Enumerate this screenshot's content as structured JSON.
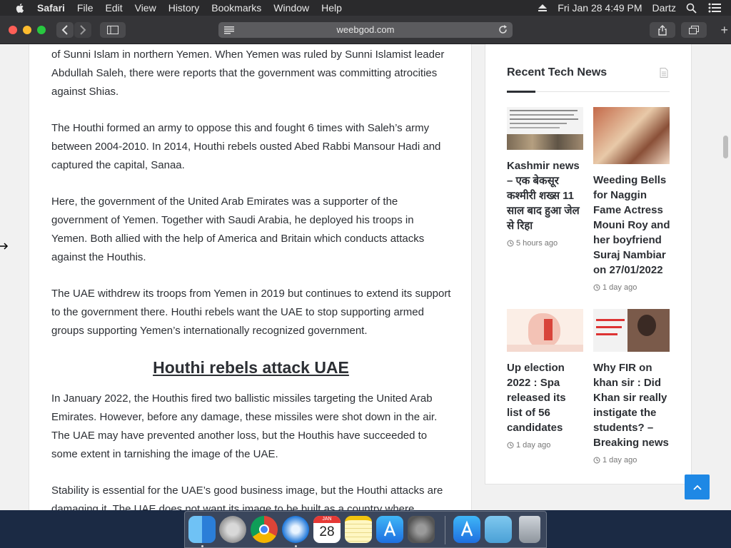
{
  "menubar": {
    "app": "Safari",
    "menus": [
      "File",
      "Edit",
      "View",
      "History",
      "Bookmarks",
      "Window",
      "Help"
    ],
    "datetime": "Fri Jan 28  4:49 PM",
    "user": "Dartz"
  },
  "browser": {
    "url": "weebgod.com"
  },
  "article": {
    "paragraphs": [
      "of Sunni Islam in northern Yemen. When Yemen was ruled by Sunni Islamist leader Abdullah Saleh, there were reports that the government was committing atrocities against Shias.",
      "The Houthi formed an army to oppose this and fought 6 times with Saleh’s army between 2004-2010. In 2014, Houthi rebels ousted Abed Rabbi Mansour Hadi and captured the capital, Sanaa.",
      "Here, the government of the United Arab Emirates was a supporter of the government of Yemen. Together with Saudi Arabia, he deployed his troops in Yemen. Both allied with the help of America and Britain which conducts attacks against the Houthis.",
      "The UAE withdrew its troops from Yemen in 2019 but continues to extend its support to the government there. Houthi rebels want the UAE to stop supporting armed groups supporting Yemen’s internationally recognized government."
    ],
    "heading": "Houthi rebels attack UAE",
    "paragraphs2": [
      "In January 2022, the Houthis fired two ballistic missiles targeting the United Arab Emirates. However, before any damage, these missiles were shot down in the air. The UAE may have prevented another loss, but the Houthis have succeeded to some extent in tarnishing the image of the UAE.",
      "Stability is essential for the UAE’s good business image, but the Houthi attacks are damaging it. The UAE does not want its image to be built as a country where"
    ]
  },
  "sidebar": {
    "title": "Recent Tech News",
    "items": [
      {
        "title": "Kashmir news – एक बेकसूर कश्मीरी शख्स 11 साल बाद हुआ जेल से रिहा",
        "time": "5 hours ago"
      },
      {
        "title": "Weeding Bells for Naggin Fame Actress Mouni Roy and her boyfriend Suraj Nambiar on 27/01/2022",
        "time": "1 day ago"
      },
      {
        "title": "Up election 2022 : Spa released its list of 56 candidates",
        "time": "1 day ago"
      },
      {
        "title": "Why FIR on khan sir : Did Khan sir really instigate the students? – Breaking news",
        "time": "1 day ago"
      }
    ]
  },
  "dock": {
    "calendar_month": "JAN",
    "calendar_day": "28"
  },
  "colors": {
    "accent": "#1e88e5",
    "text": "#2c2f34"
  }
}
